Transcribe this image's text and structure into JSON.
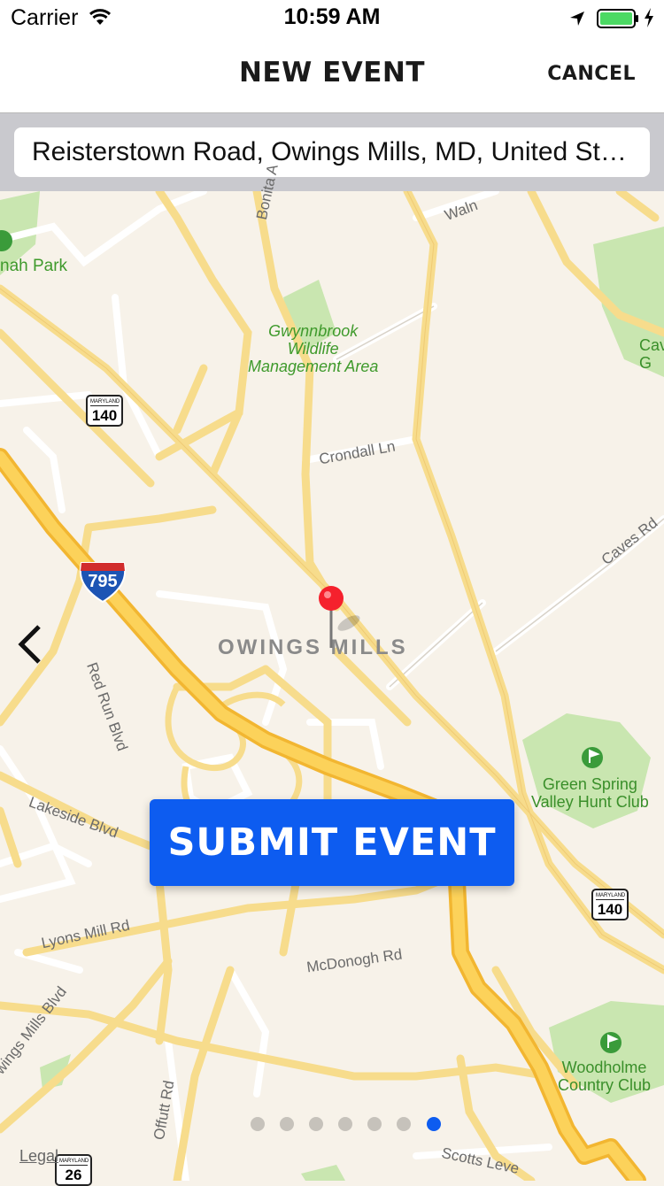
{
  "status_bar": {
    "carrier": "Carrier",
    "time": "10:59 AM",
    "battery_color": "#4cd964"
  },
  "nav": {
    "title": "NEW EVENT",
    "cancel_label": "CANCEL"
  },
  "search": {
    "address_value": "Reisterstown Road, Owings Mills, MD, United States"
  },
  "map": {
    "pois": {
      "gwynnbrook": "Gwynnbrook\nWildlife\nManagement Area",
      "green_spring": "Green Spring\nValley Hunt Club",
      "woodholme": "Woodholme\nCountry Club",
      "park_partial": "nah\nPark",
      "cave_partial": "Cav\nG"
    },
    "roads": {
      "bonita": "Bonita A",
      "walnut": "Waln",
      "crondall": "Crondall Ln",
      "caves": "Caves Rd",
      "red_run": "Red Run Blvd",
      "lakeside": "Lakeside Blvd",
      "lyons_mill": "Lyons Mill Rd",
      "mcdonogh": "McDonogh Rd",
      "owings_mills_blvd": "Owings Mills Blvd",
      "offutt": "Offutt Rd",
      "scotts": "Scotts Leve"
    },
    "town": "OWINGS MILLS",
    "shields": {
      "state_label": "MARYLAND",
      "route_140": "140",
      "route_26": "26",
      "interstate": "795"
    },
    "legal": "Legal"
  },
  "submit_label": "SUBMIT EVENT",
  "page_indicator": {
    "count": 7,
    "active_index": 6,
    "active_color": "#0d5cf0"
  },
  "colors": {
    "accent": "#0d5cf0",
    "map_bg": "#f7f2e9",
    "highway": "#f7c948",
    "park": "#c9e6b0"
  }
}
